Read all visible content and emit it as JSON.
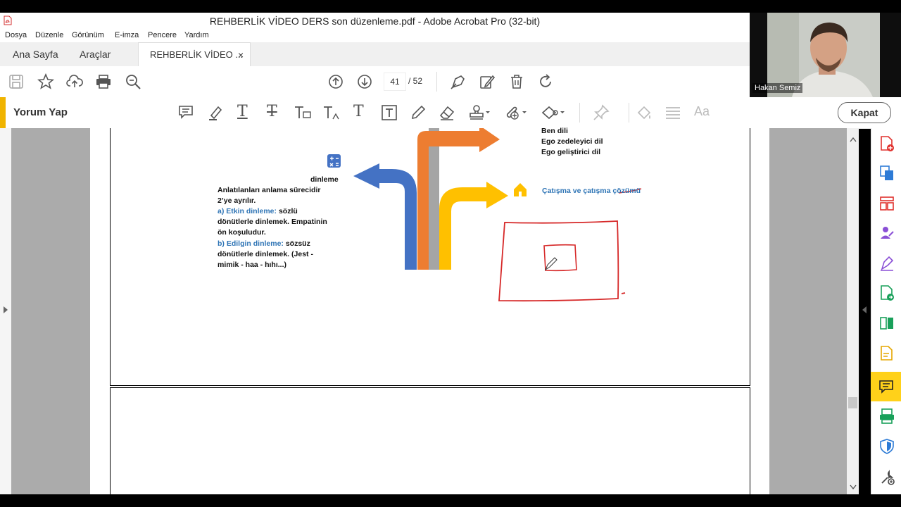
{
  "window": {
    "title": "REHBERLİK VİDEO DERS son düzenleme.pdf - Adobe Acrobat Pro (32-bit)"
  },
  "menu": [
    "Dosya",
    "Düzenle",
    "Görünüm",
    "E-imza",
    "Pencere",
    "Yardım"
  ],
  "tabs": {
    "home": "Ana Sayfa",
    "tools": "Araçlar",
    "document": "REHBERLİK VİDEO ...",
    "close": "×"
  },
  "toolbar": {
    "current_page": "41",
    "page_total": "/ 52"
  },
  "comment_bar": {
    "title": "Yorum Yap",
    "close_label": "Kapat",
    "font_tool": "Aa"
  },
  "page": {
    "right_list": [
      "Ben dili",
      "Ego zedeleyici dil",
      "Ego geliştirici dil"
    ],
    "conflict_label": "Çatışma ve çatışma çözümü",
    "listen_heading": "dinleme",
    "listen_intro": [
      "Anlatılanları anlama sürecidir",
      "2’ye ayrılır."
    ],
    "active_label": "a) Etkin dinleme:",
    "active_text": [
      "sözlü",
      "dönütlerle dinlemek. Empatinin",
      "ön koşuludur."
    ],
    "passive_label": "b) Edilgin dinleme:",
    "passive_text": [
      "sözsüz",
      "dönütlerle dinlemek. (Jest -",
      "mimik - haa - hıhı...)"
    ]
  },
  "webcam": {
    "name": "Hakan Semiz"
  },
  "colors": {
    "blue": "#4472c4",
    "orange": "#ed7d31",
    "gray": "#a5a5a5",
    "yellow": "#ffc000",
    "accent": "#f0b400",
    "ink": "#d62828"
  }
}
